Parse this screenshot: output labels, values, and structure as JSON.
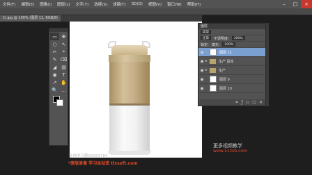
{
  "menu": [
    "文件(F)",
    "编辑(E)",
    "图像(I)",
    "图层(L)",
    "文字(Y)",
    "选择(S)",
    "滤镜(T)",
    "3D(D)",
    "视图(V)",
    "窗口(W)",
    "帮助(H)"
  ],
  "window_controls": [
    "–",
    "□",
    "×"
  ],
  "document_tab": "Ci.jpg @ 100% (图层 11, RGB/8)",
  "tools": [
    "▭",
    "✥",
    "○",
    "↖",
    "✂",
    "⌖",
    "✎",
    "⌫",
    "◢",
    "▥",
    "◉",
    "T",
    "↗",
    "✋",
    "🔍",
    "…"
  ],
  "layers_panel": {
    "title": "图层",
    "kind": "类型",
    "mode": "正常",
    "opacity_label": "不透明度:",
    "opacity": "100%",
    "lock_label": "锁定:",
    "fill_label": "填充:",
    "fill": "100%",
    "layers": [
      {
        "name": "图层 11",
        "type": "layer",
        "selected": true
      },
      {
        "name": "生产 副本",
        "type": "group",
        "selected": false
      },
      {
        "name": "生产",
        "type": "group",
        "selected": false
      },
      {
        "name": "图层 9",
        "type": "layer",
        "selected": false
      },
      {
        "name": "图层 10",
        "type": "layer",
        "selected": false
      }
    ]
  },
  "watermarks": {
    "qq": "在线学习群92063784",
    "bottom": "*原版录像 学习本站班 tlxsoft.com",
    "right_title": "更多视频教学",
    "right_url": "www.51zxb.com"
  }
}
